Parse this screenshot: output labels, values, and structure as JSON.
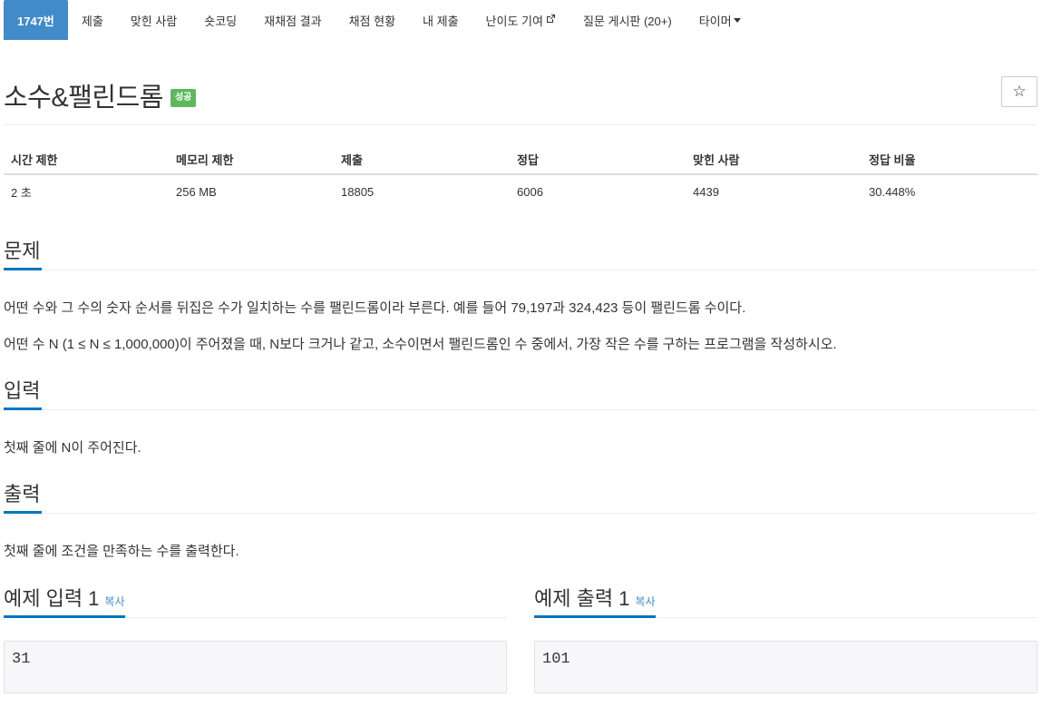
{
  "nav": {
    "tabs": [
      {
        "label": "1747번",
        "active": true
      },
      {
        "label": "제출"
      },
      {
        "label": "맞힌 사람"
      },
      {
        "label": "숏코딩"
      },
      {
        "label": "재채점 결과"
      },
      {
        "label": "채점 현황"
      },
      {
        "label": "내 제출"
      },
      {
        "label": "난이도 기여",
        "icon": "external-link-icon"
      },
      {
        "label": "질문 게시판 (20+)"
      },
      {
        "label": "타이머",
        "icon": "caret-down-icon"
      }
    ]
  },
  "problem": {
    "title": "소수&팰린드롬",
    "status_badge": "성공",
    "star_icon": "☆"
  },
  "info": {
    "headers": [
      "시간 제한",
      "메모리 제한",
      "제출",
      "정답",
      "맞힌 사람",
      "정답 비율"
    ],
    "values": [
      "2 초",
      "256 MB",
      "18805",
      "6006",
      "4439",
      "30.448%"
    ]
  },
  "description": {
    "heading": "문제",
    "paragraphs": [
      "어떤 수와 그 수의 숫자 순서를 뒤집은 수가 일치하는 수를 팰린드롬이라 부른다. 예를 들어 79,197과 324,423 등이 팰린드롬 수이다.",
      "어떤 수 N (1 ≤ N ≤ 1,000,000)이 주어졌을 때, N보다 크거나 같고, 소수이면서 팰린드롬인 수 중에서, 가장 작은 수를 구하는 프로그램을 작성하시오."
    ]
  },
  "input": {
    "heading": "입력",
    "text": "첫째 줄에 N이 주어진다."
  },
  "output": {
    "heading": "출력",
    "text": "첫째 줄에 조건을 만족하는 수를 출력한다."
  },
  "samples": {
    "input_heading": "예제 입력 1",
    "output_heading": "예제 출력 1",
    "copy_label": "복사",
    "input_value": "31",
    "output_value": "101"
  },
  "colors": {
    "accent": "#428bca",
    "success": "#5cb85c",
    "underline": "#0076c0"
  }
}
